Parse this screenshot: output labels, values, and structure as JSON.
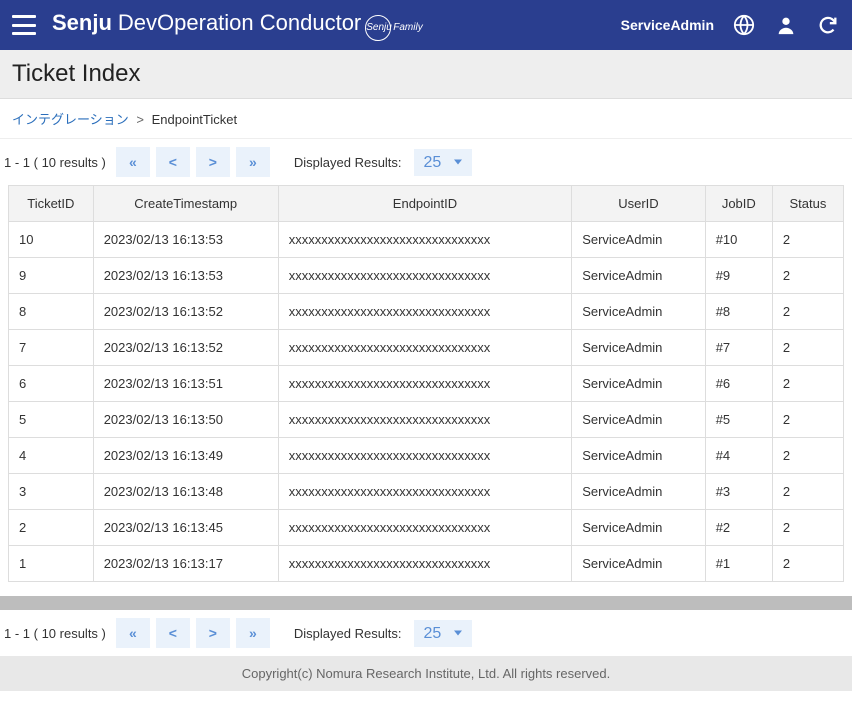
{
  "header": {
    "brand_main": "Senju",
    "brand_sub": "DevOperation Conductor",
    "brand_family_circle": "Senju",
    "brand_family_text": "Family",
    "username": "ServiceAdmin"
  },
  "page": {
    "title": "Ticket Index"
  },
  "breadcrumb": {
    "link": "インテグレーション",
    "sep": ">",
    "current": "EndpointTicket"
  },
  "toolbar": {
    "results_text": "1 - 1 ( 10 results )",
    "first": "«",
    "prev": "<",
    "next": ">",
    "last": "»",
    "displayed_label": "Displayed Results:",
    "displayed_value": "25"
  },
  "table": {
    "headers": [
      "TicketID",
      "CreateTimestamp",
      "EndpointID",
      "UserID",
      "JobID",
      "Status"
    ],
    "rows": [
      {
        "ticket_id": "10",
        "ts": "2023/02/13 16:13:53",
        "endpoint": "xxxxxxxxxxxxxxxxxxxxxxxxxxxxxxx",
        "user": "ServiceAdmin",
        "job": "#10",
        "status": "2"
      },
      {
        "ticket_id": "9",
        "ts": "2023/02/13 16:13:53",
        "endpoint": "xxxxxxxxxxxxxxxxxxxxxxxxxxxxxxx",
        "user": "ServiceAdmin",
        "job": "#9",
        "status": "2"
      },
      {
        "ticket_id": "8",
        "ts": "2023/02/13 16:13:52",
        "endpoint": "xxxxxxxxxxxxxxxxxxxxxxxxxxxxxxx",
        "user": "ServiceAdmin",
        "job": "#8",
        "status": "2"
      },
      {
        "ticket_id": "7",
        "ts": "2023/02/13 16:13:52",
        "endpoint": "xxxxxxxxxxxxxxxxxxxxxxxxxxxxxxx",
        "user": "ServiceAdmin",
        "job": "#7",
        "status": "2"
      },
      {
        "ticket_id": "6",
        "ts": "2023/02/13 16:13:51",
        "endpoint": "xxxxxxxxxxxxxxxxxxxxxxxxxxxxxxx",
        "user": "ServiceAdmin",
        "job": "#6",
        "status": "2"
      },
      {
        "ticket_id": "5",
        "ts": "2023/02/13 16:13:50",
        "endpoint": "xxxxxxxxxxxxxxxxxxxxxxxxxxxxxxx",
        "user": "ServiceAdmin",
        "job": "#5",
        "status": "2"
      },
      {
        "ticket_id": "4",
        "ts": "2023/02/13 16:13:49",
        "endpoint": "xxxxxxxxxxxxxxxxxxxxxxxxxxxxxxx",
        "user": "ServiceAdmin",
        "job": "#4",
        "status": "2"
      },
      {
        "ticket_id": "3",
        "ts": "2023/02/13 16:13:48",
        "endpoint": "xxxxxxxxxxxxxxxxxxxxxxxxxxxxxxx",
        "user": "ServiceAdmin",
        "job": "#3",
        "status": "2"
      },
      {
        "ticket_id": "2",
        "ts": "2023/02/13 16:13:45",
        "endpoint": "xxxxxxxxxxxxxxxxxxxxxxxxxxxxxxx",
        "user": "ServiceAdmin",
        "job": "#2",
        "status": "2"
      },
      {
        "ticket_id": "1",
        "ts": "2023/02/13 16:13:17",
        "endpoint": "xxxxxxxxxxxxxxxxxxxxxxxxxxxxxxx",
        "user": "ServiceAdmin",
        "job": "#1",
        "status": "2"
      }
    ]
  },
  "footer": {
    "copyright": "Copyright(c) Nomura Research Institute, Ltd. All rights reserved."
  }
}
